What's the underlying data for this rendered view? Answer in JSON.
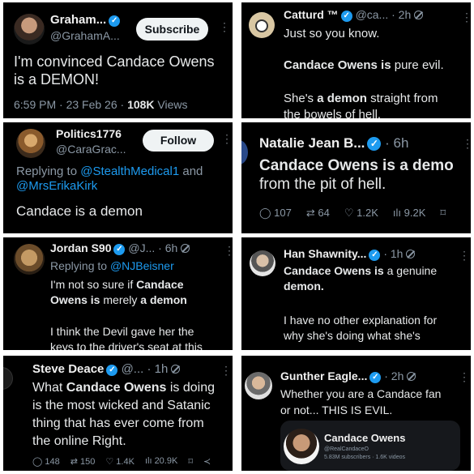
{
  "colors": {
    "background": "#000000",
    "accent": "#1d9bf0",
    "text": "#e7e9ea",
    "muted": "#8b98a5"
  },
  "posts": [
    {
      "name": "Graham...",
      "handle": "@GrahamA...",
      "action": "Subscribe",
      "text": "I'm convinced Candace Owens is a DEMON!",
      "time": "6:59 PM · 23 Feb 26 · ",
      "views": "108K",
      "views_label": " Views"
    },
    {
      "name": "Catturd ™",
      "handle": "@ca...",
      "time": "· 2h",
      "line1": "Just so you know.",
      "line2_a": "Candace Owens",
      "line2_b": " is ",
      "line2_c": "pure evil.",
      "line3_a": "She's ",
      "line3_b": "a demon",
      "line3_c": " straight from",
      "line4": "the bowels of hell."
    },
    {
      "name": "Politics1776",
      "handle": "@CaraGrac...",
      "action": "Follow",
      "reply_prefix": "Replying to ",
      "reply_user1": "@StealthMedical1",
      "reply_and": " and",
      "reply_user2": "@MrsErikaKirk",
      "text": "Candace is a demon"
    },
    {
      "name": "Natalie Jean B...",
      "time": "· 6h",
      "text_a": "Candace Owens",
      "text_b": " is ",
      "text_c": "a demo",
      "text_d": "from the pit of hell.",
      "replies": "107",
      "reposts": "64",
      "likes": "1.2K",
      "views": "9.2K"
    },
    {
      "name": "Jordan S90",
      "handle": "@J...",
      "time": "· 6h",
      "reply_prefix": "Replying to ",
      "reply_user": "@NJBeisner",
      "line1": "I'm not so sure if ",
      "line1_b": "Candace",
      "line2_a": "Owens",
      "line2_b": " is ",
      "line2_c": "merely ",
      "line2_d": "a demon",
      "line3": "I think the Devil gave her the",
      "line4": "keys to the driver's seat at this"
    },
    {
      "name": "Han Shawnity...",
      "time": "· 1h",
      "line1_a": "Candace Owens",
      "line1_b": " is ",
      "line1_c": "a genuine",
      "line2": "demon.",
      "line3": "I have no other explanation for",
      "line4": "why she's doing what she's"
    },
    {
      "name": "Steve Deace",
      "handle": "@...",
      "time": "· 1h",
      "line1_a": "What ",
      "line1_b": "Candace",
      "line1_c": " ",
      "line1_d": "Owens",
      "line1_e": " is doing",
      "line2": "is the most wicked and Satanic",
      "line3": "thing that has ever come from",
      "line4": "the online Right.",
      "replies": "148",
      "reposts": "150",
      "likes": "1.4K",
      "views": "20.9K"
    },
    {
      "name": "Gunther Eagle...",
      "time": "· 2h",
      "line1": "Whether you are a Candace fan",
      "line2": "or not... THIS IS EVIL.",
      "card_title": "Candace Owens",
      "card_handle": "@RealCandaceO",
      "card_stats": "5.83M subscribers · 1.6K videos"
    }
  ]
}
